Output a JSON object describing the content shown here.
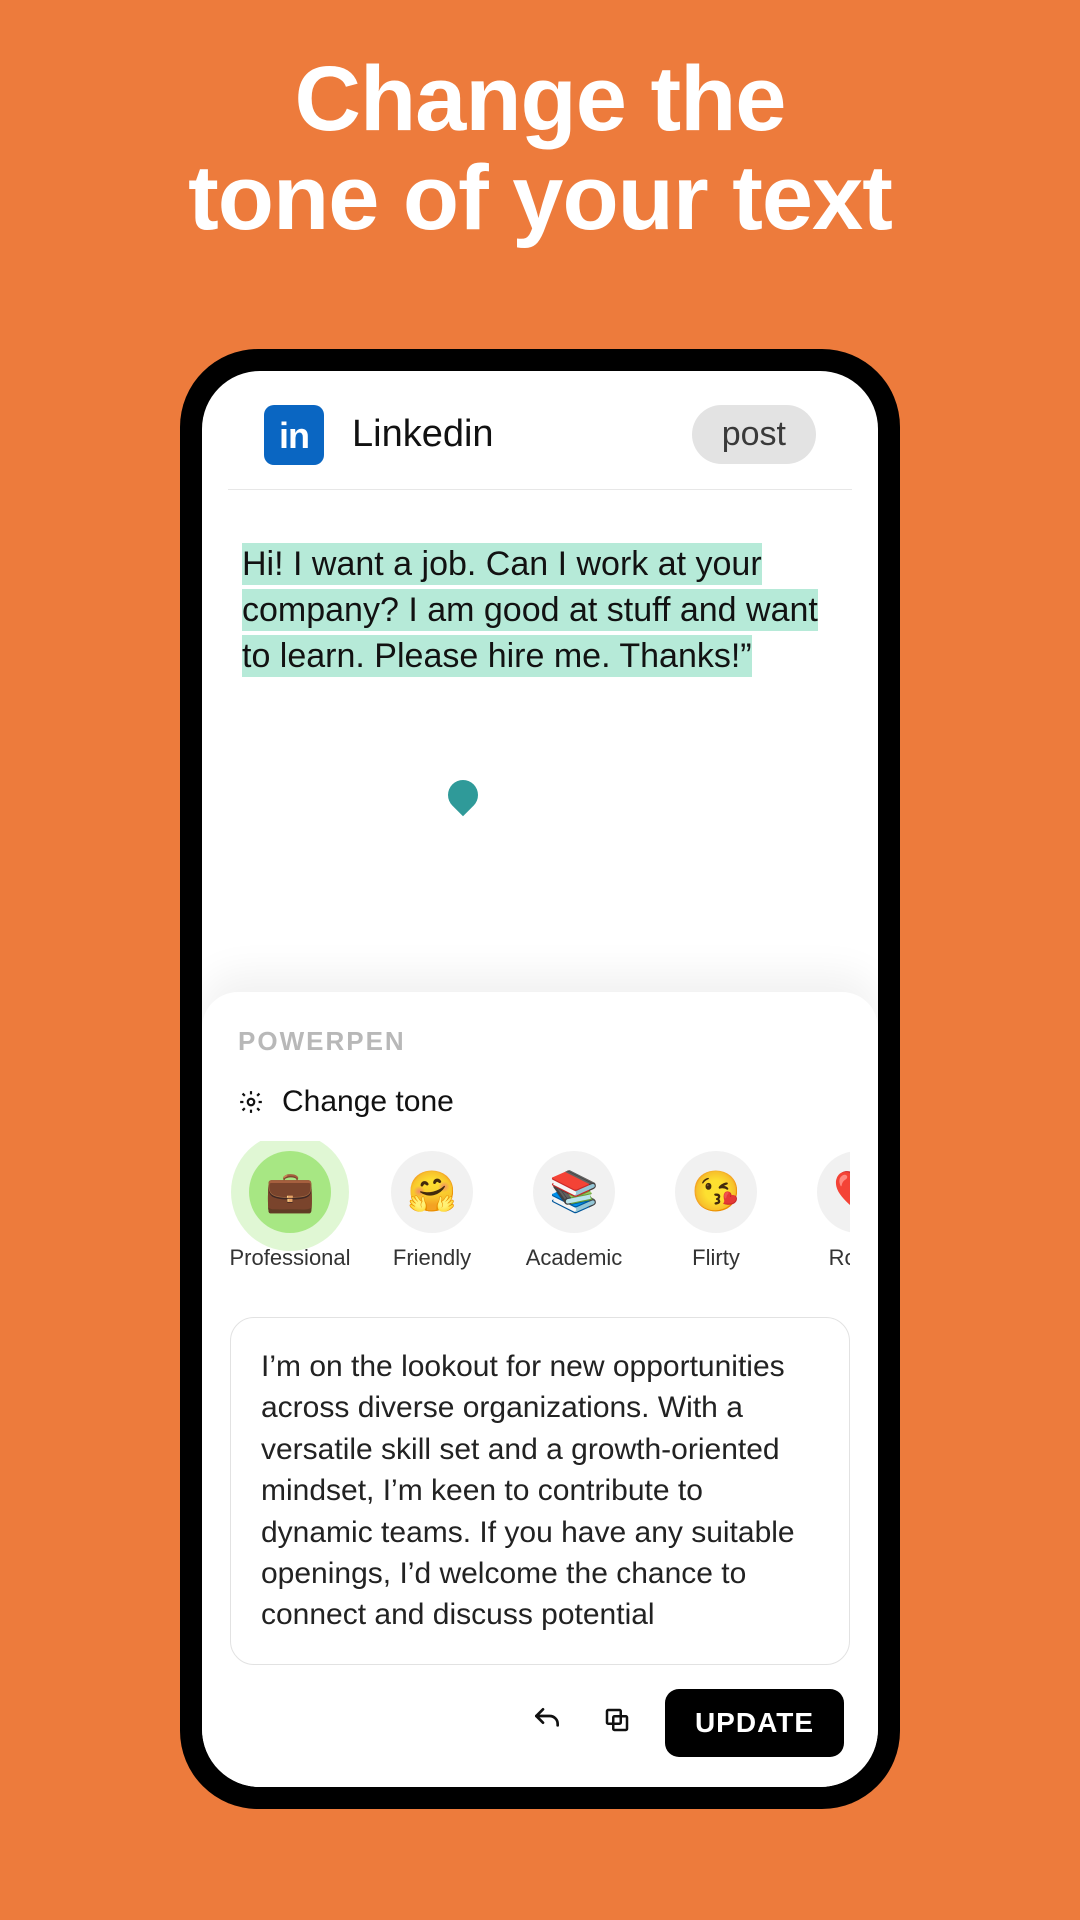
{
  "hero": {
    "line1": "Change the",
    "line2": "tone of your text"
  },
  "topbar": {
    "icon_label": "in",
    "app_name": "Linkedin",
    "post_label": "post"
  },
  "composer": {
    "text": "Hi! I want a job. Can I work at your company? I am good at stuff and want to learn. Please hire me. Thanks!”"
  },
  "panel": {
    "brand": "POWERPEN",
    "section_label": "Change tone",
    "tones": [
      {
        "emoji": "💼",
        "label": "Professional",
        "selected": true
      },
      {
        "emoji": "🤗",
        "label": "Friendly",
        "selected": false
      },
      {
        "emoji": "📚",
        "label": "Academic",
        "selected": false
      },
      {
        "emoji": "😘",
        "label": "Flirty",
        "selected": false
      },
      {
        "emoji": "❤️",
        "label": "Roma",
        "selected": false
      }
    ],
    "output_text": "I’m on the lookout for new opportunities across diverse organizations. With a versatile skill set and a growth-oriented mindset, I’m keen to contribute to dynamic teams. If you have any suitable openings, I’d welcome the chance to connect and discuss potential",
    "update_label": "UPDATE"
  }
}
